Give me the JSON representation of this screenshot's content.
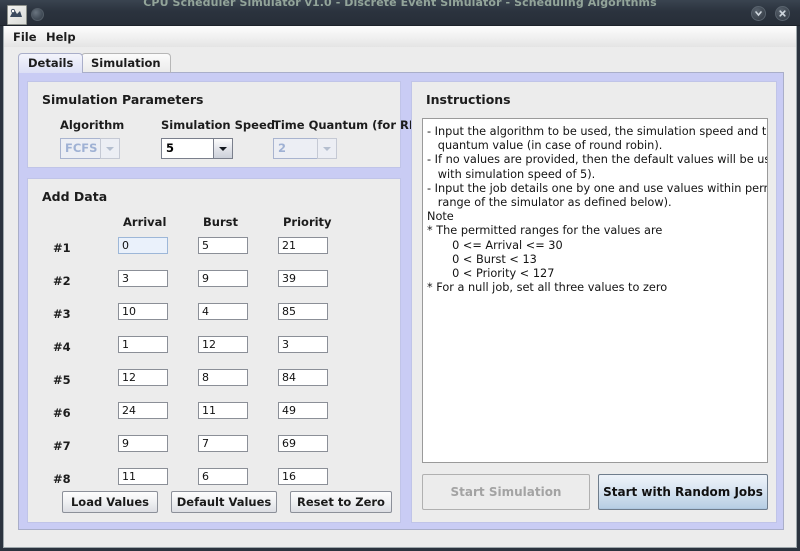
{
  "window": {
    "title": "CPU Scheduler Simulator v1.0 - Discrete Event Simulator - Scheduling Algorithms",
    "app_icon": "app-icon",
    "controls": [
      {
        "name": "minimize-button",
        "icon": "chevron-down-icon"
      },
      {
        "name": "close-button",
        "icon": "close-icon"
      }
    ]
  },
  "menubar": {
    "items": [
      {
        "label": "File"
      },
      {
        "label": "Help"
      }
    ]
  },
  "tabs": [
    {
      "label": "Details",
      "active": true
    },
    {
      "label": "Simulation",
      "active": false
    }
  ],
  "simulation_parameters": {
    "title": "Simulation Parameters",
    "algorithm": {
      "label": "Algorithm",
      "value": "FCFS",
      "enabled": false
    },
    "simulation_speed": {
      "label": "Simulation Speed",
      "value": "5",
      "enabled": true
    },
    "time_quantum": {
      "label": "Time Quantum (for RR)",
      "value": "2",
      "enabled": false
    }
  },
  "add_data": {
    "title": "Add Data",
    "columns": [
      "Arrival",
      "Burst",
      "Priority"
    ],
    "rows": [
      {
        "label": "#1",
        "arrival": "0",
        "burst": "5",
        "priority": "21"
      },
      {
        "label": "#2",
        "arrival": "3",
        "burst": "9",
        "priority": "39"
      },
      {
        "label": "#3",
        "arrival": "10",
        "burst": "4",
        "priority": "85"
      },
      {
        "label": "#4",
        "arrival": "1",
        "burst": "12",
        "priority": "3"
      },
      {
        "label": "#5",
        "arrival": "12",
        "burst": "8",
        "priority": "84"
      },
      {
        "label": "#6",
        "arrival": "24",
        "burst": "11",
        "priority": "49"
      },
      {
        "label": "#7",
        "arrival": "9",
        "burst": "7",
        "priority": "69"
      },
      {
        "label": "#8",
        "arrival": "11",
        "burst": "6",
        "priority": "16"
      }
    ],
    "buttons": [
      {
        "label": "Load Values"
      },
      {
        "label": "Default Values"
      },
      {
        "label": "Reset to Zero"
      }
    ]
  },
  "instructions": {
    "title": "Instructions",
    "lines": [
      "- Input the algorithm to be used, the simulation speed and the time",
      "   quantum value (in case of round robin).",
      "- If no values are provided, then the default values will be used (FCFS,",
      "   with simulation speed of 5).",
      "- Input the job details one by one and use values within permitted",
      "   range of the simulator as defined below).",
      "Note",
      "* The permitted ranges for the values are",
      "       0 <= Arrival <= 30",
      "       0 < Burst < 13",
      "       0 < Priority < 127",
      "* For a null job, set all three values to zero"
    ]
  },
  "actions": {
    "start_simulation": {
      "label": "Start Simulation",
      "enabled": false
    },
    "start_random": {
      "label": "Start with Random Jobs",
      "enabled": true
    }
  },
  "colors": {
    "tab_panel_bg": "#c9ccf4",
    "panel_bg": "#ececec",
    "accent_button": "#b8cfe4",
    "disabled_text": "#9fb1d4",
    "titlebar": "#2b333e"
  }
}
